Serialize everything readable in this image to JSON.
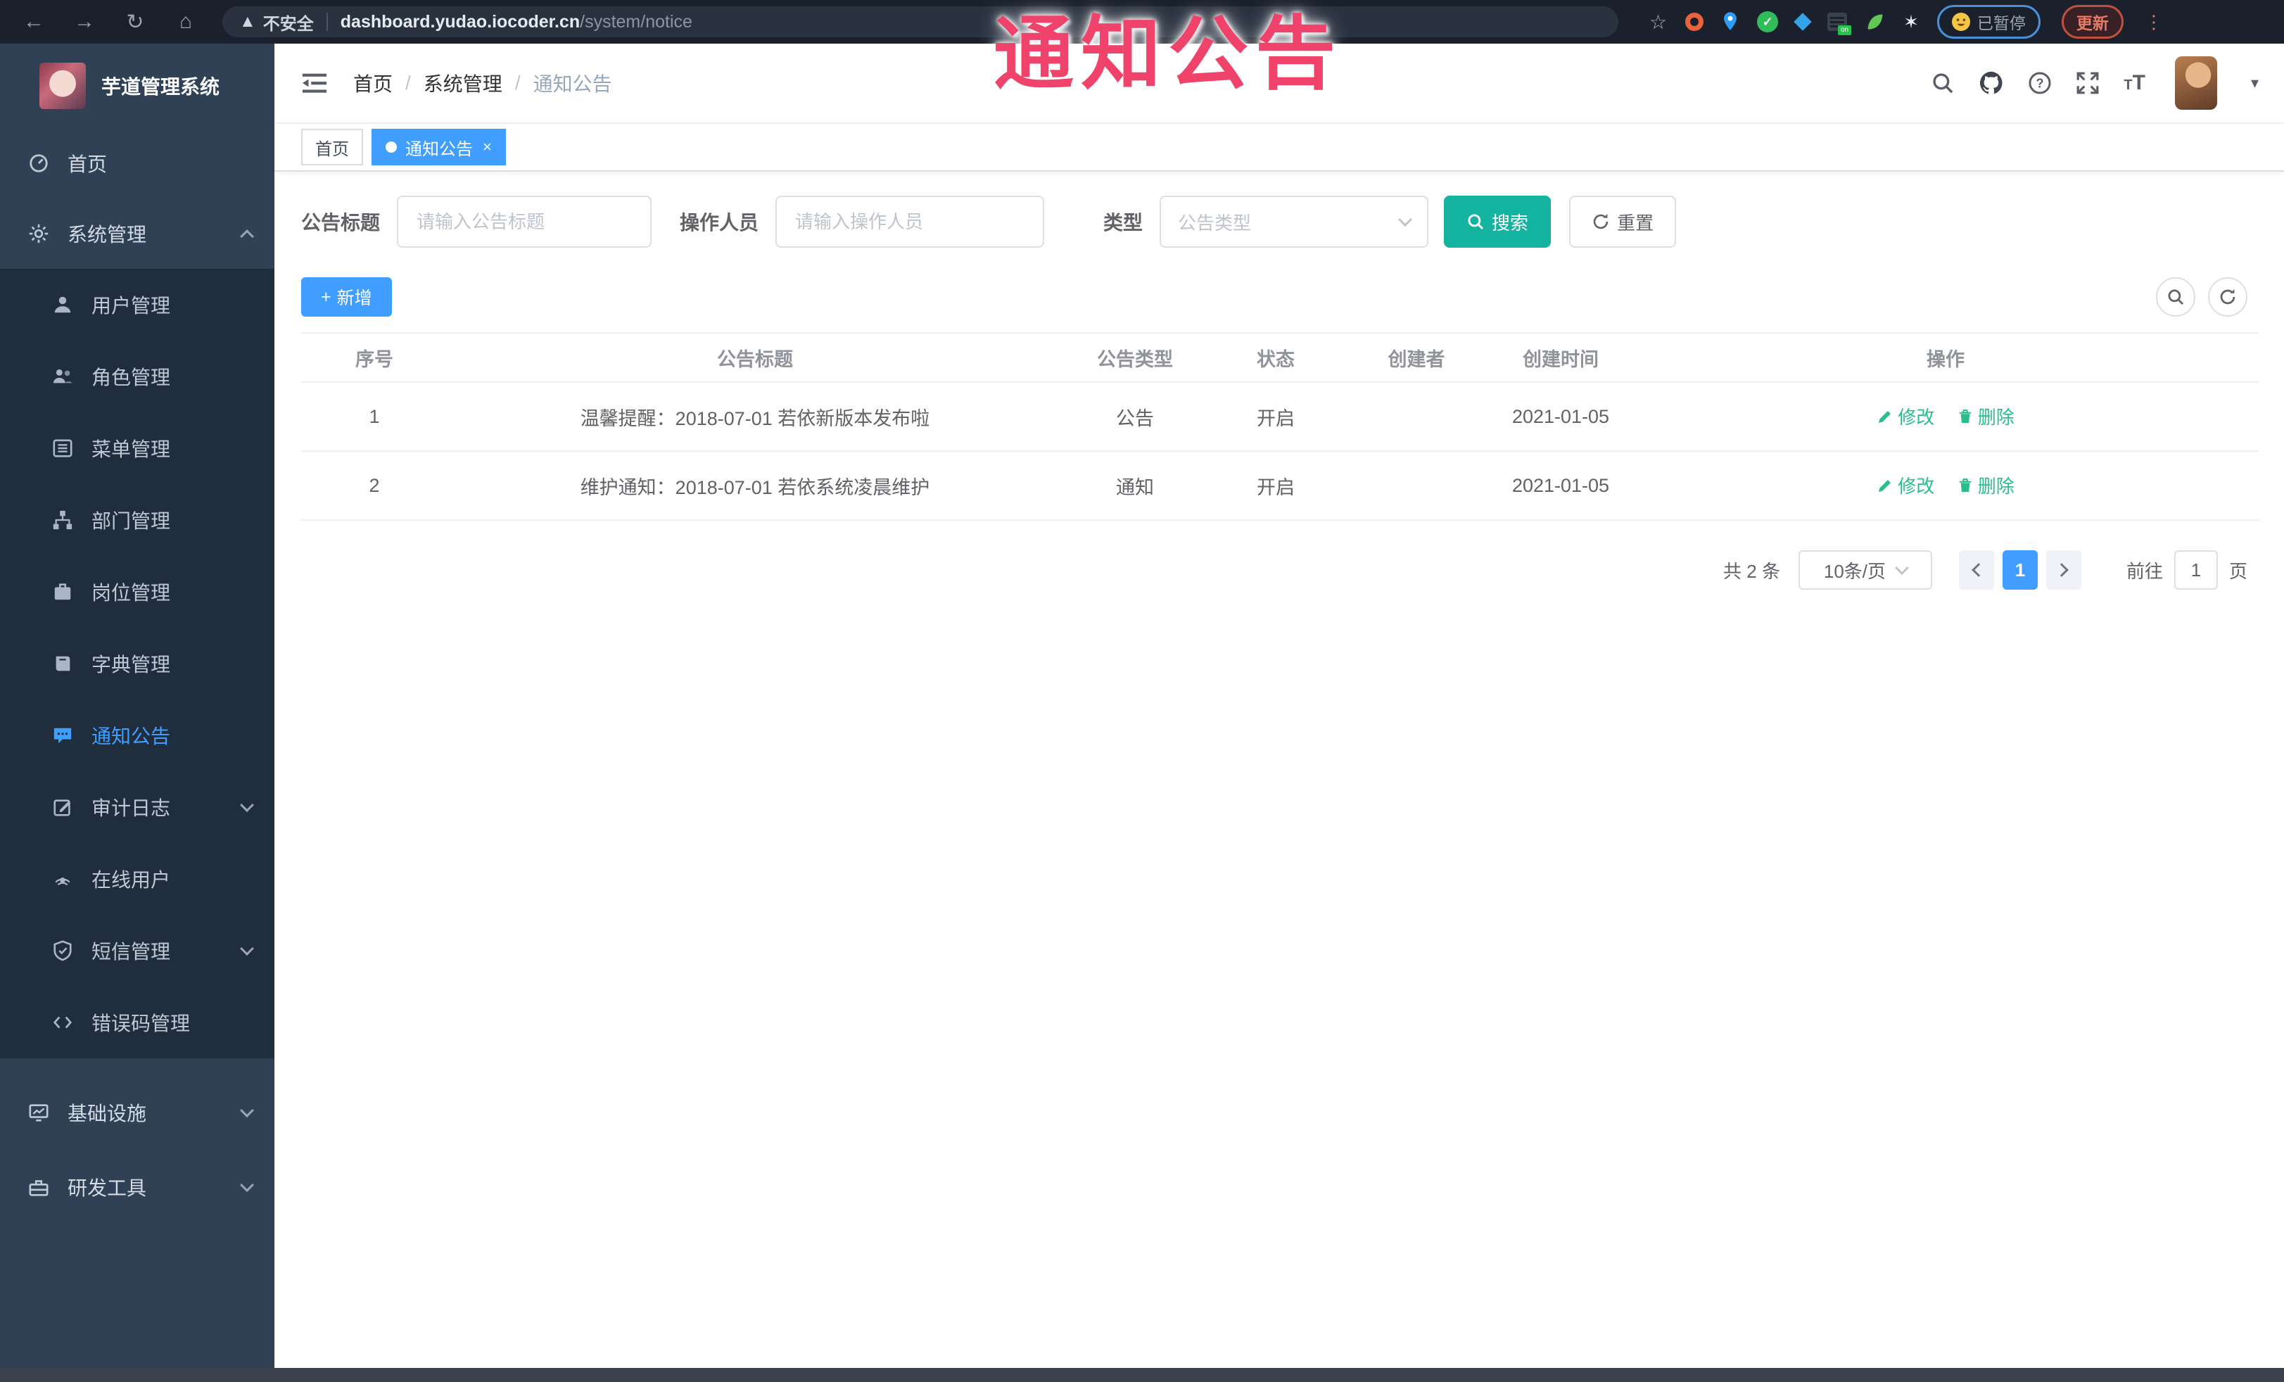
{
  "browser": {
    "security_label": "不安全",
    "url_host": "dashboard.yudao.iocoder.cn",
    "url_path": "/system/notice",
    "paused_label": "已暂停",
    "update_label": "更新"
  },
  "annotation": {
    "text": "通知公告",
    "color": "#f0436b"
  },
  "sidebar": {
    "title": "芋道管理系统",
    "items": [
      {
        "label": "首页",
        "icon": "dashboard-icon"
      },
      {
        "label": "系统管理",
        "icon": "gear-icon",
        "state": "expanded"
      },
      {
        "label": "用户管理",
        "icon": "user-icon"
      },
      {
        "label": "角色管理",
        "icon": "roles-icon"
      },
      {
        "label": "菜单管理",
        "icon": "menu-list-icon"
      },
      {
        "label": "部门管理",
        "icon": "org-tree-icon"
      },
      {
        "label": "岗位管理",
        "icon": "post-icon"
      },
      {
        "label": "字典管理",
        "icon": "dict-book-icon"
      },
      {
        "label": "通知公告",
        "icon": "notice-bubble-icon",
        "state": "active"
      },
      {
        "label": "审计日志",
        "icon": "audit-log-icon",
        "state": "collapsed"
      },
      {
        "label": "在线用户",
        "icon": "online-users-icon"
      },
      {
        "label": "短信管理",
        "icon": "sms-shield-icon",
        "state": "collapsed"
      },
      {
        "label": "错误码管理",
        "icon": "error-code-icon"
      },
      {
        "label": "基础设施",
        "icon": "infrastructure-icon",
        "state": "collapsed"
      },
      {
        "label": "研发工具",
        "icon": "dev-tools-icon",
        "state": "collapsed"
      }
    ]
  },
  "header": {
    "breadcrumb": {
      "home": "首页",
      "section": "系统管理",
      "current": "通知公告",
      "separator": "/"
    }
  },
  "tabs": [
    {
      "label": "首页"
    },
    {
      "label": "通知公告",
      "active": true,
      "close": "×"
    }
  ],
  "filters": {
    "title_label": "公告标题",
    "title_placeholder": "请输入公告标题",
    "operator_label": "操作人员",
    "operator_placeholder": "请输入操作人员",
    "type_label": "类型",
    "type_placeholder": "公告类型",
    "search_label": "搜索",
    "reset_label": "重置"
  },
  "toolbar": {
    "add_label": "新增",
    "plus": "+"
  },
  "table": {
    "columns": {
      "index": "序号",
      "title": "公告标题",
      "type": "公告类型",
      "status": "状态",
      "creator": "创建者",
      "create_time": "创建时间",
      "actions": "操作"
    },
    "rows": [
      {
        "index": "1",
        "title": "温馨提醒：2018-07-01 若依新版本发布啦",
        "type": "公告",
        "status": "开启",
        "creator": "",
        "create_time": "2021-01-05",
        "edit_label": "修改",
        "delete_label": "删除"
      },
      {
        "index": "2",
        "title": "维护通知：2018-07-01 若依系统凌晨维护",
        "type": "通知",
        "status": "开启",
        "creator": "",
        "create_time": "2021-01-05",
        "edit_label": "修改",
        "delete_label": "删除"
      }
    ]
  },
  "pagination": {
    "total_text": "共 2 条",
    "page_size": "10条/页",
    "current_page": "1",
    "goto_label": "前往",
    "goto_value": "1",
    "page_unit": "页"
  },
  "colors": {
    "accent": "#409eff",
    "search_button": "#14b3a0",
    "action_link": "#2bbd8d",
    "annotation": "#f0436b",
    "sidebar_bg": "#304156",
    "submenu_bg": "#1f2d3d"
  }
}
